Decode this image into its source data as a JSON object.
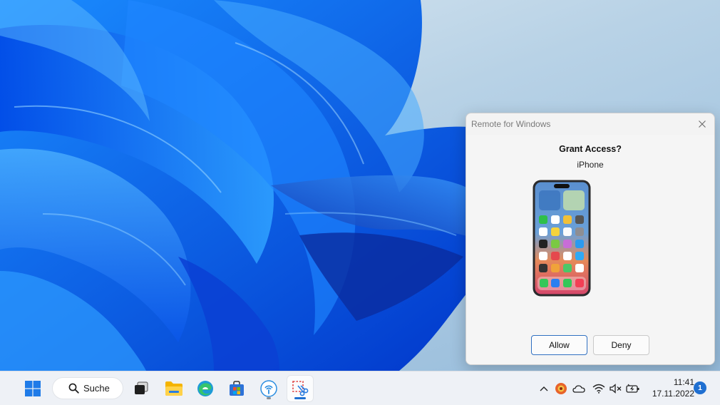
{
  "dialog": {
    "window_title": "Remote for Windows",
    "heading": "Grant Access?",
    "device_name": "iPhone",
    "allow_label": "Allow",
    "deny_label": "Deny"
  },
  "taskbar": {
    "search_label": "Suche",
    "apps": [
      {
        "name": "start-button",
        "icon": "windows-logo-icon"
      },
      {
        "name": "task-view-button",
        "icon": "task-view-icon"
      },
      {
        "name": "file-explorer-button",
        "icon": "folder-icon"
      },
      {
        "name": "edge-button",
        "icon": "edge-icon"
      },
      {
        "name": "store-button",
        "icon": "store-icon"
      },
      {
        "name": "remote-app-button",
        "icon": "remote-app-icon"
      },
      {
        "name": "snipping-tool-button",
        "icon": "snipping-tool-icon"
      }
    ],
    "tray": {
      "icons": [
        "chevron-up-icon",
        "app-tray-icon",
        "cloud-icon",
        "wifi-icon",
        "volume-muted-icon",
        "battery-icon"
      ],
      "time": "11:41",
      "date": "17.11.2022",
      "notification_count": "1"
    }
  },
  "colors": {
    "accent": "#1e6fd0",
    "wallpaper_blue": "#0a4fe0"
  }
}
